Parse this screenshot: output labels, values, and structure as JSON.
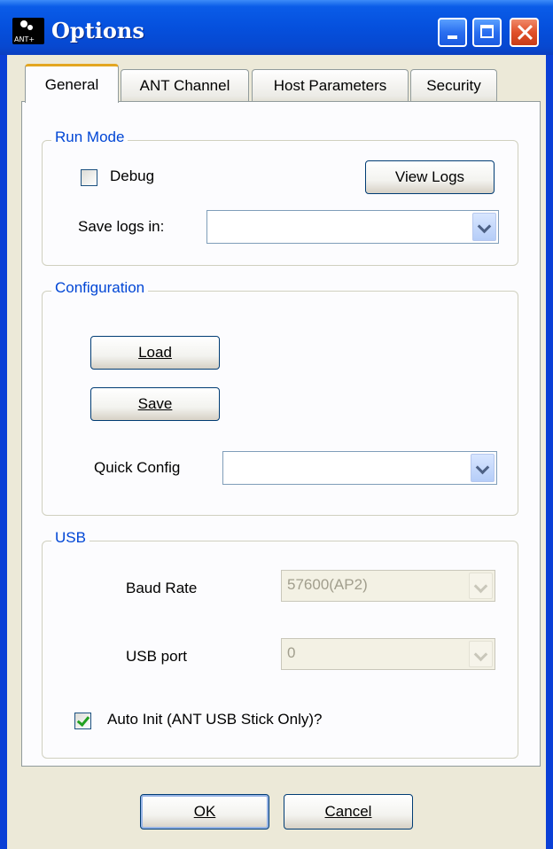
{
  "window": {
    "title": "Options",
    "icon_text": "ANT+"
  },
  "tabs": [
    "General",
    "ANT Channel",
    "Host Parameters",
    "Security"
  ],
  "run_mode": {
    "title": "Run Mode",
    "debug_label": "Debug",
    "debug_checked": false,
    "view_logs_label": "View Logs",
    "save_logs_label": "Save logs in:",
    "save_logs_value": ""
  },
  "configuration": {
    "title": "Configuration",
    "load_label": "Load",
    "save_label": "Save",
    "quick_config_label": "Quick Config",
    "quick_config_value": ""
  },
  "usb": {
    "title": "USB",
    "baud_rate_label": "Baud Rate",
    "baud_rate_value": "57600(AP2)",
    "usb_port_label": "USB port",
    "usb_port_value": "0",
    "auto_init_label": "Auto Init (ANT USB Stick Only)?",
    "auto_init_checked": true
  },
  "footer": {
    "ok_label": "OK",
    "cancel_label": "Cancel"
  }
}
